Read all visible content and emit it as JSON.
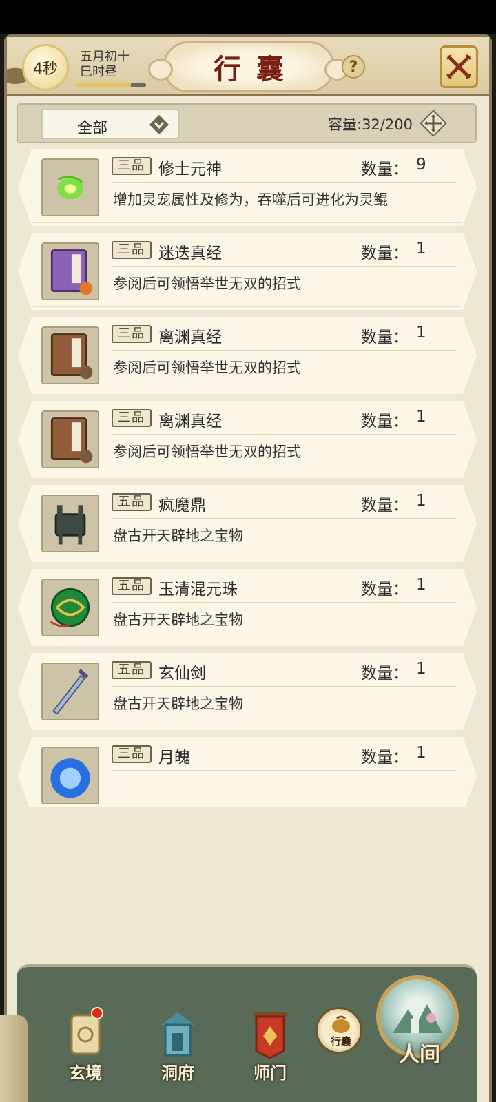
{
  "header": {
    "timer": "4秒",
    "date_line1": "五月初十",
    "date_line2": "巳时昼",
    "time_progress": 0.78,
    "title": "行囊",
    "help_symbol": "?"
  },
  "filter": {
    "selected": "全部",
    "capacity": "容量:32/200"
  },
  "qty_label": "数量：",
  "items": [
    {
      "grade": "三品",
      "name": "修士元神",
      "qty": "9",
      "desc": "增加灵宠属性及修为，吞噬后可进化为灵鲲",
      "icon": "spirit-orb-icon"
    },
    {
      "grade": "三品",
      "name": "迷迭真经",
      "qty": "1",
      "desc": "参阅后可领悟举世无双的招式",
      "icon": "fire-scripture-book-icon",
      "badge": "火"
    },
    {
      "grade": "三品",
      "name": "离渊真经",
      "qty": "1",
      "desc": "参阅后可领悟举世无双的招式",
      "icon": "earth-scripture-book-icon",
      "badge": "土"
    },
    {
      "grade": "三品",
      "name": "离渊真经",
      "qty": "1",
      "desc": "参阅后可领悟举世无双的招式",
      "icon": "earth-scripture-book-icon",
      "badge": "土"
    },
    {
      "grade": "五品",
      "name": "疯魔鼎",
      "qty": "1",
      "desc": "盘古开天辟地之宝物",
      "icon": "bronze-cauldron-icon"
    },
    {
      "grade": "五品",
      "name": "玉清混元珠",
      "qty": "1",
      "desc": "盘古开天辟地之宝物",
      "icon": "jade-pearl-icon"
    },
    {
      "grade": "五品",
      "name": "玄仙剑",
      "qty": "1",
      "desc": "盘古开天辟地之宝物",
      "icon": "immortal-sword-icon"
    },
    {
      "grade": "三品",
      "name": "月魄",
      "qty": "1",
      "desc": "",
      "icon": "moon-soul-icon"
    }
  ],
  "nav": {
    "xuanjing": "玄境",
    "dongfu": "洞府",
    "shimen": "师门",
    "bag": "行囊",
    "world": "人间"
  },
  "colors": {
    "parchment": "#eee7d3",
    "title_red": "#7a1d12",
    "nav_green": "#586a58"
  }
}
